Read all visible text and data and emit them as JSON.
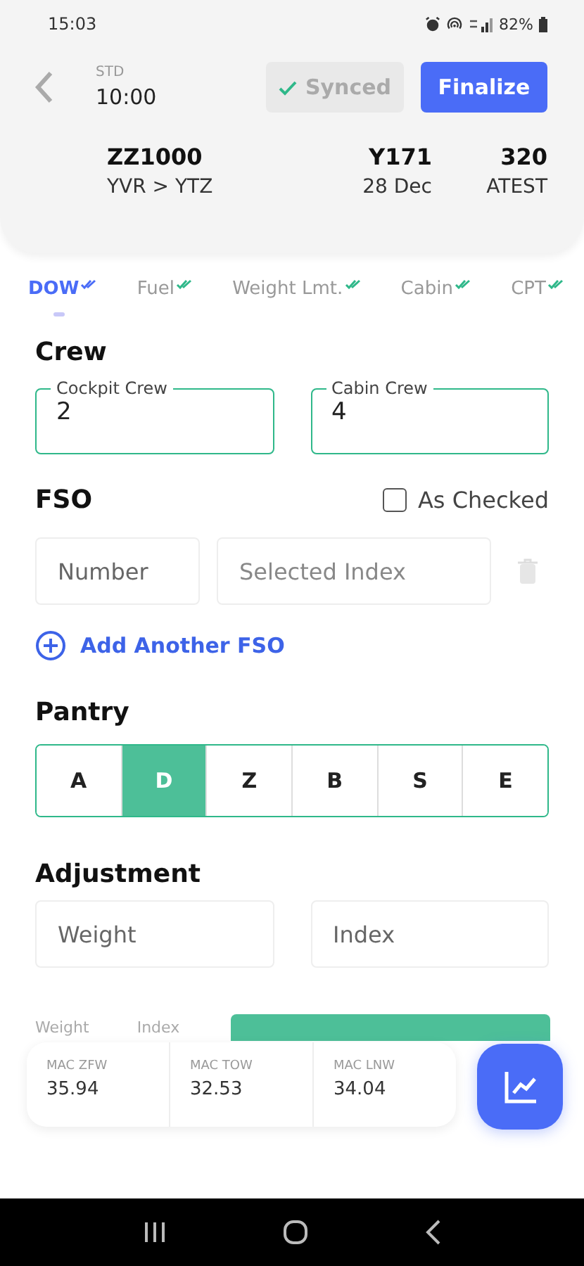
{
  "status_bar": {
    "time": "15:03",
    "battery": "82%"
  },
  "header": {
    "std_label": "STD",
    "std_time": "10:00",
    "synced": {
      "label": "Synced",
      "done": true
    },
    "finalize": "Finalize",
    "flight": "ZZ1000",
    "route": "YVR > YTZ",
    "reg": "Y171",
    "date": "28 Dec",
    "type": "320",
    "config": "ATEST"
  },
  "tabs": [
    {
      "label": "DOW",
      "selected": true,
      "done": true
    },
    {
      "label": "Fuel",
      "selected": false,
      "done": true
    },
    {
      "label": "Weight Lmt.",
      "selected": false,
      "done": true
    },
    {
      "label": "Cabin",
      "selected": false,
      "done": true
    },
    {
      "label": "CPT",
      "selected": false,
      "done": true
    }
  ],
  "crew": {
    "title": "Crew",
    "fields": [
      {
        "label": "Cockpit Crew",
        "value": "2"
      },
      {
        "label": "Cabin Crew",
        "value": "4"
      }
    ]
  },
  "fso": {
    "title": "FSO",
    "as_checked": {
      "label": "As Checked",
      "checked": false
    },
    "number": {
      "placeholder": "Number"
    },
    "index": {
      "placeholder": "Selected Index"
    },
    "add": "Add Another FSO"
  },
  "pantry": {
    "title": "Pantry",
    "options": [
      {
        "label": "A",
        "selected": false
      },
      {
        "label": "D",
        "selected": true
      },
      {
        "label": "Z",
        "selected": false
      },
      {
        "label": "B",
        "selected": false
      },
      {
        "label": "S",
        "selected": false
      },
      {
        "label": "E",
        "selected": false
      }
    ]
  },
  "adjustment": {
    "title": "Adjustment",
    "weight": {
      "placeholder": "Weight"
    },
    "index": {
      "placeholder": "Index"
    }
  },
  "hidden_labels": [
    "Weight",
    "Index"
  ],
  "summary": [
    {
      "label": "MAC ZFW",
      "value": "35.94"
    },
    {
      "label": "MAC TOW",
      "value": "32.53"
    },
    {
      "label": "MAC LNW",
      "value": "34.04"
    }
  ]
}
